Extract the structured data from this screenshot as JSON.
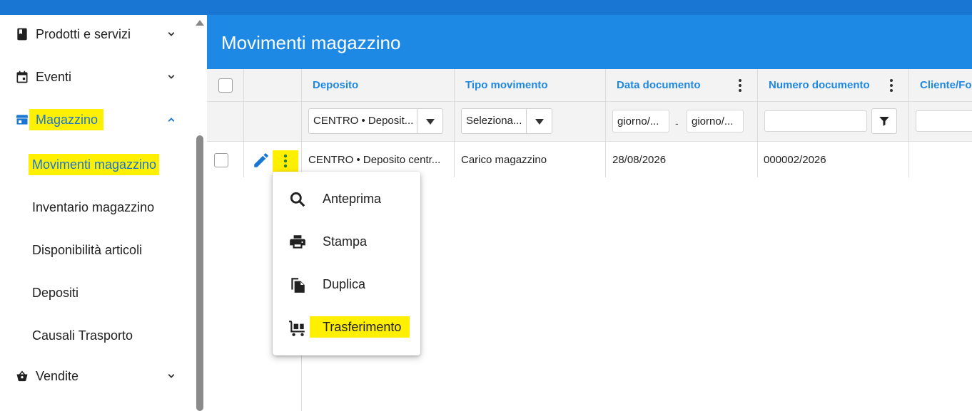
{
  "sidebar": {
    "items": [
      {
        "label": "Prodotti e servizi",
        "icon": "book-icon"
      },
      {
        "label": "Eventi",
        "icon": "calendar-icon"
      },
      {
        "label": "Magazzino",
        "icon": "store-icon"
      },
      {
        "label": "Vendite",
        "icon": "basket-icon"
      }
    ],
    "subitems": [
      {
        "label": "Movimenti magazzino"
      },
      {
        "label": "Inventario magazzino"
      },
      {
        "label": "Disponibilità articoli"
      },
      {
        "label": "Depositi"
      },
      {
        "label": "Causali Trasporto"
      }
    ]
  },
  "header": {
    "title": "Movimenti magazzino"
  },
  "colors": {
    "primary": "#1976d2",
    "header": "#1e88e5",
    "highlight": "#ffef00"
  },
  "grid": {
    "columns": [
      "Deposito",
      "Tipo movimento",
      "Data documento",
      "Numero documento",
      "Cliente/Fo"
    ],
    "filters": {
      "deposito": "CENTRO • Deposit...",
      "tipo": "Seleziona...",
      "data_da": "giorno/...",
      "data_sep": "-",
      "data_a": "giorno/..."
    },
    "rows": [
      {
        "deposito": "CENTRO • Deposito centr...",
        "tipo": "Carico magazzino",
        "data": "28/08/2026",
        "numero": "000002/2026",
        "cliente": ""
      }
    ]
  },
  "menu": {
    "items": [
      {
        "label": "Anteprima",
        "icon": "search-icon"
      },
      {
        "label": "Stampa",
        "icon": "print-icon"
      },
      {
        "label": "Duplica",
        "icon": "copy-icon"
      },
      {
        "label": "Trasferimento",
        "icon": "cart-transfer-icon"
      }
    ]
  }
}
